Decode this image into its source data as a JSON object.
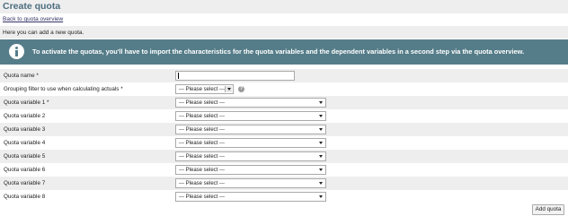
{
  "page": {
    "title": "Create quota",
    "back_link": "Back to quota overview",
    "intro": "Here you can add a new quota."
  },
  "info_box": {
    "icon": "info-icon",
    "text": "To activate the quotas, you'll have to import the characteristics for the quota variables and the dependent variables in a second step via the quota overview."
  },
  "form": {
    "quota_name": {
      "label": "Quota name *",
      "value": ""
    },
    "grouping_filter": {
      "label": "Grouping filter to use when calculating actuals *",
      "selected": "--- Please select ---",
      "help_icon": "help-icon",
      "help_glyph": "?"
    },
    "quota_variables": [
      {
        "label": "Quota variable 1 *",
        "selected": "--- Please select ---"
      },
      {
        "label": "Quota variable 2",
        "selected": "--- Please select ---"
      },
      {
        "label": "Quota variable 3",
        "selected": "--- Please select ---"
      },
      {
        "label": "Quota variable 4",
        "selected": "--- Please select ---"
      },
      {
        "label": "Quota variable 5",
        "selected": "--- Please select ---"
      },
      {
        "label": "Quota variable 6",
        "selected": "--- Please select ---"
      },
      {
        "label": "Quota variable 7",
        "selected": "--- Please select ---"
      },
      {
        "label": "Quota variable 8",
        "selected": "--- Please select ---"
      }
    ]
  },
  "actions": {
    "add_quota": "Add quota"
  },
  "colors": {
    "title": "#4c6d7f",
    "info_box_bg": "#557d89",
    "row_shade": "#eeeeee"
  }
}
